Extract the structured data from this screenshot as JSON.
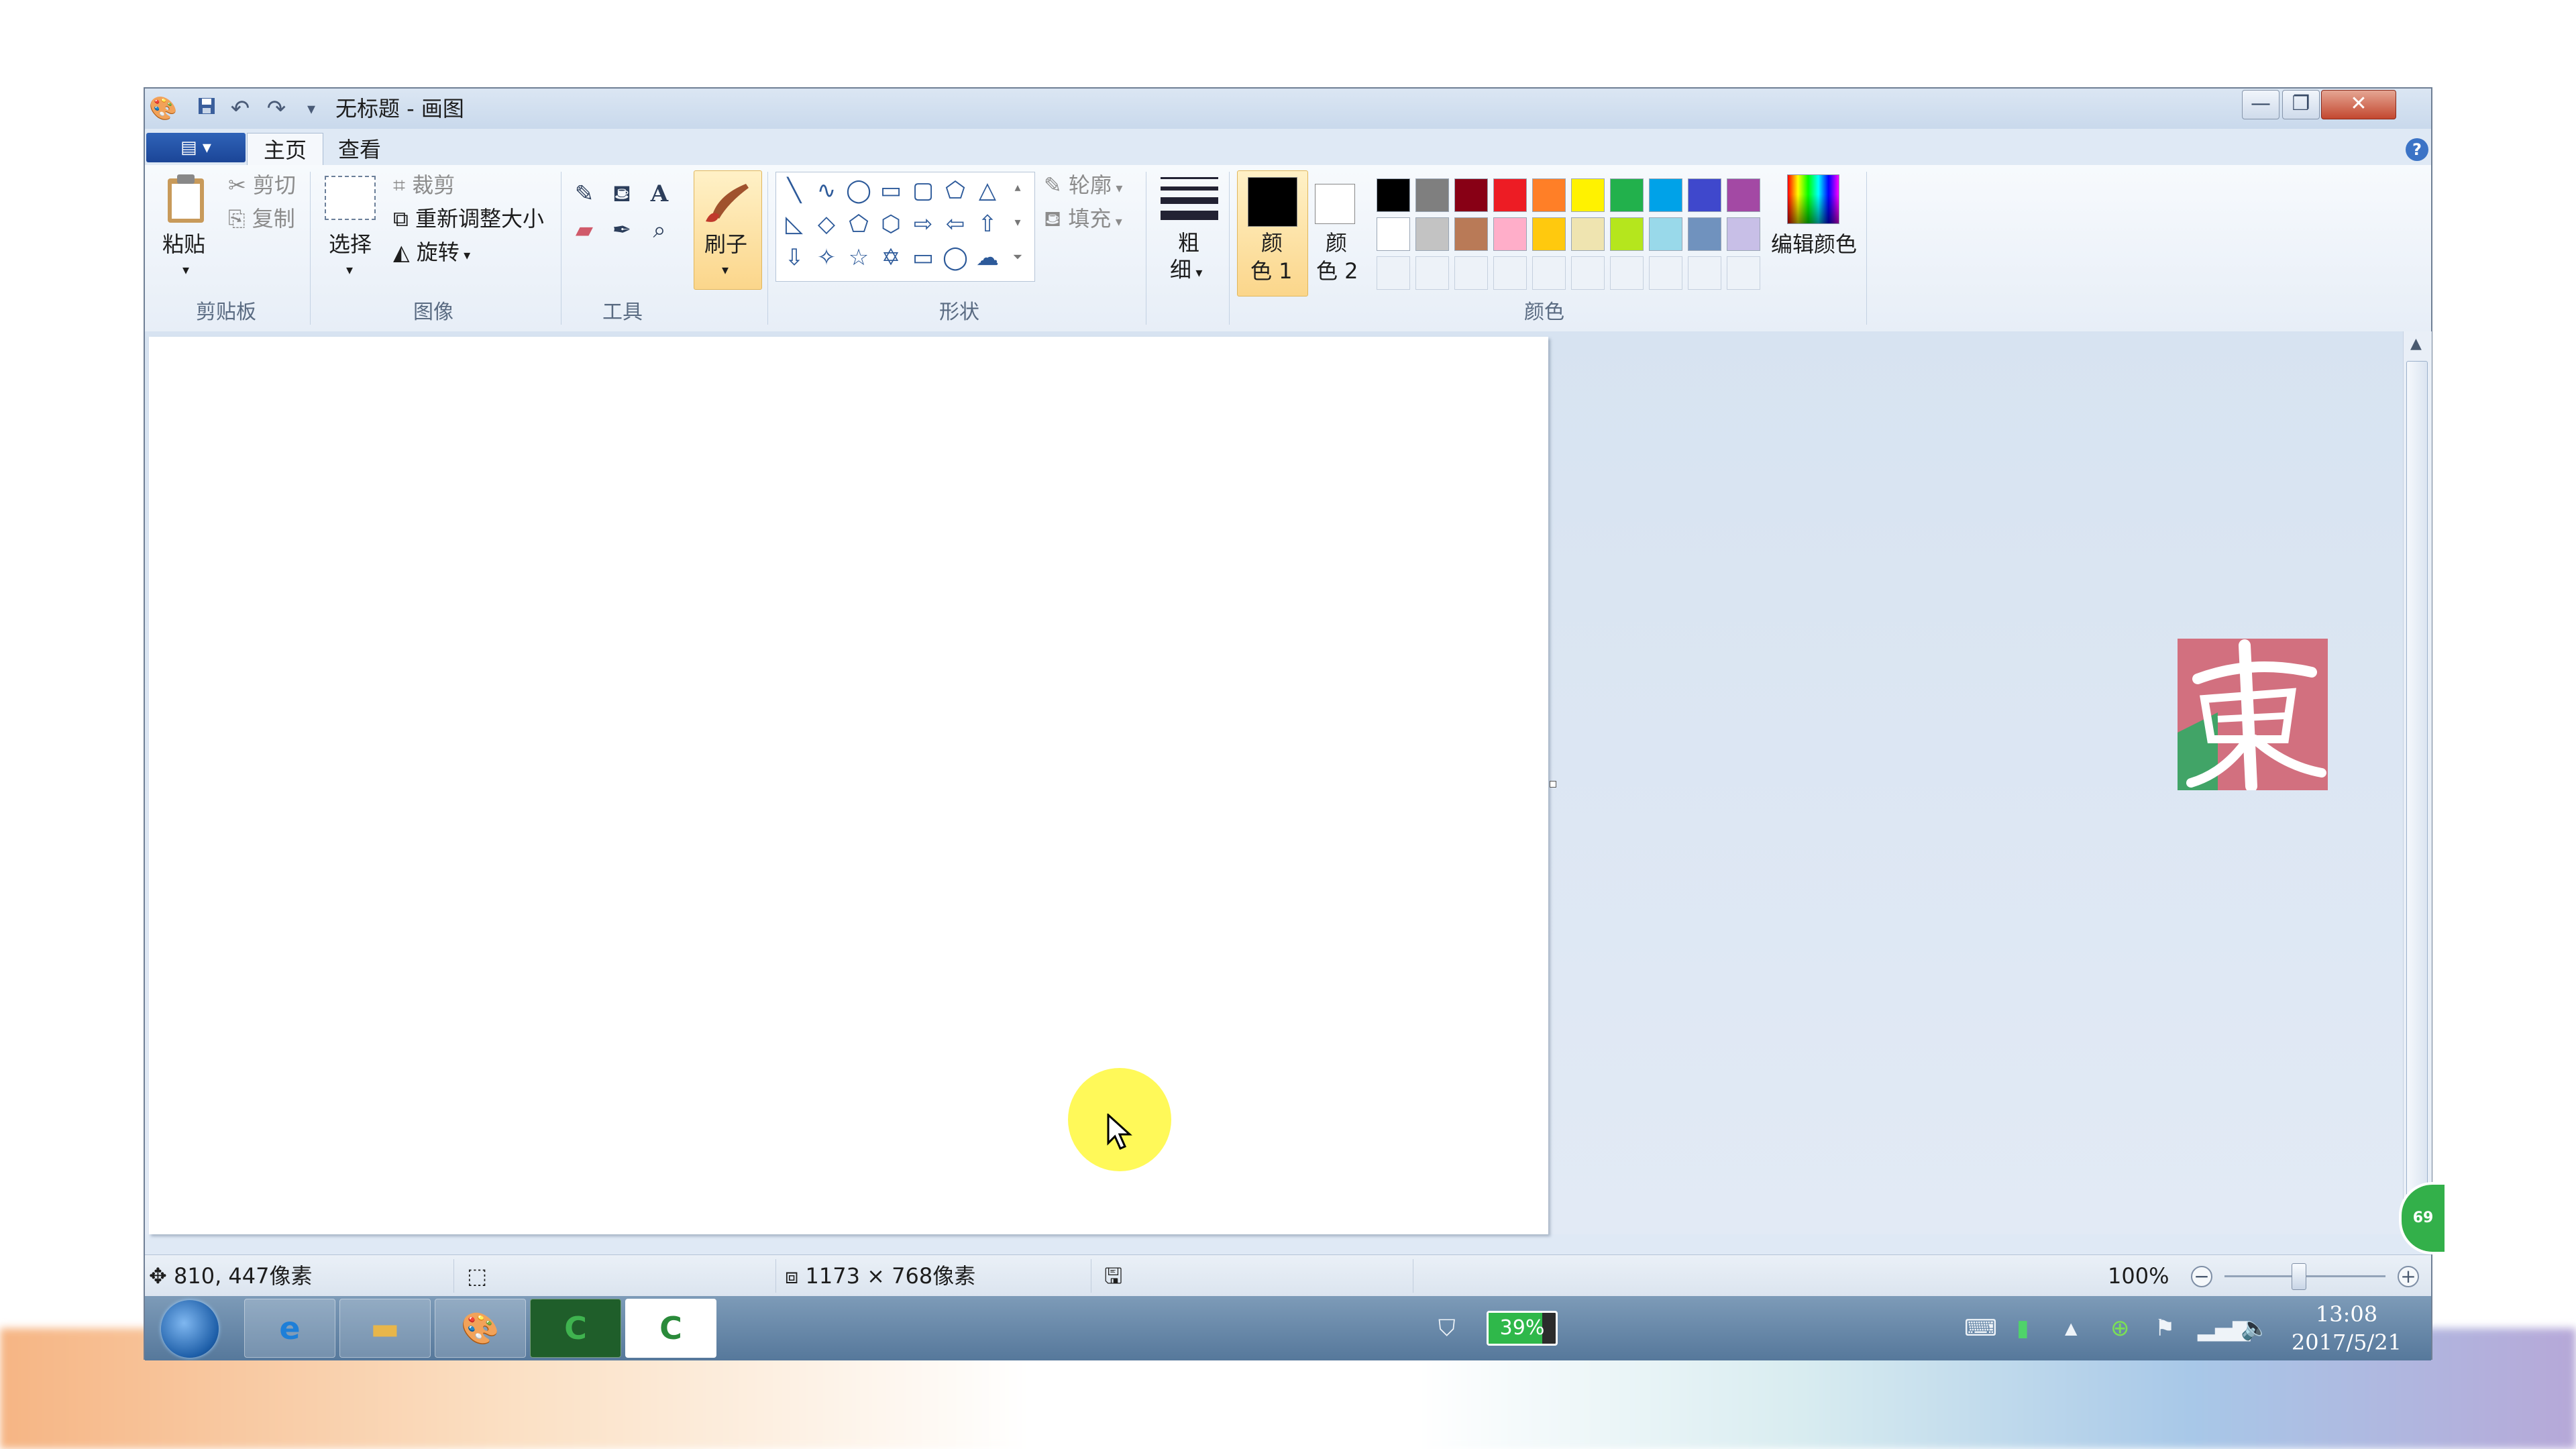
{
  "window": {
    "title": "无标题 - 画图"
  },
  "tabs": {
    "home": "主页",
    "view": "查看"
  },
  "clipboard": {
    "paste": "粘贴",
    "cut": "剪切",
    "copy": "复制",
    "group": "剪贴板"
  },
  "image": {
    "select": "选择",
    "crop": "裁剪",
    "resize": "重新调整大小",
    "rotate": "旋转",
    "group": "图像"
  },
  "tools": {
    "group": "工具"
  },
  "brushes": {
    "label": "刷子"
  },
  "shapes": {
    "outline": "轮廓",
    "fill": "填充",
    "group": "形状"
  },
  "size": {
    "label_line1": "粗",
    "label_line2": "细"
  },
  "colors": {
    "color1_line1": "颜",
    "color1_line2": "色 1",
    "color2_line1": "颜",
    "color2_line2": "色 2",
    "edit": "编辑颜色",
    "group": "颜色",
    "color1": "#000000",
    "color2": "#ffffff",
    "palette_row1": [
      "#000000",
      "#7f7f7f",
      "#880015",
      "#ed1c24",
      "#ff7f27",
      "#fff200",
      "#22b14c",
      "#00a2e8",
      "#3f48cc",
      "#a349a4"
    ],
    "palette_row2": [
      "#ffffff",
      "#c3c3c3",
      "#b97a57",
      "#ffaec9",
      "#ffc90e",
      "#efe4b0",
      "#b5e61d",
      "#99d9ea",
      "#7092be",
      "#c8bfe7"
    ]
  },
  "status": {
    "cursor_pos": "810, 447像素",
    "canvas_size": "1173 × 768像素",
    "zoom": "100%"
  },
  "taskbar": {
    "battery": "39%",
    "time": "13:08",
    "date": "2017/5/21"
  },
  "badge": {
    "text": "69"
  }
}
